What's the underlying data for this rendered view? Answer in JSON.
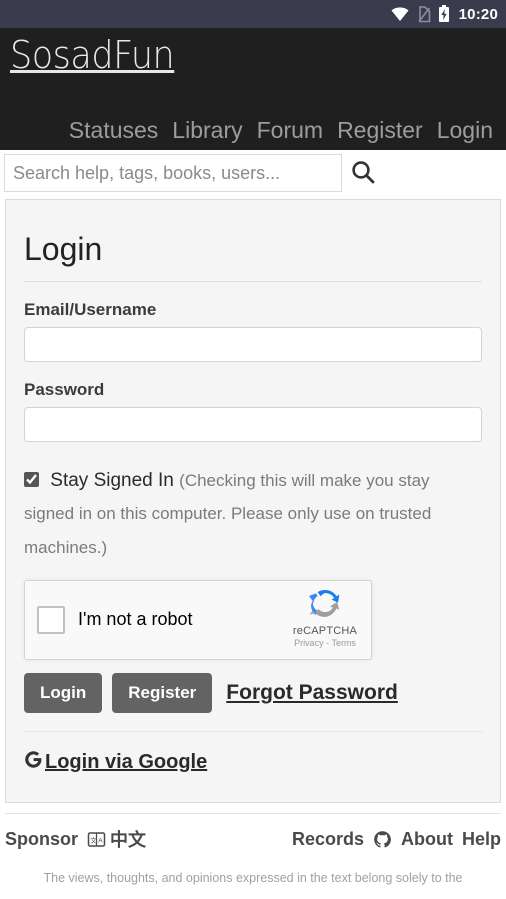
{
  "statusbar": {
    "time": "10:20",
    "icons": [
      "wifi-icon",
      "no-sim-icon",
      "battery-charging-icon"
    ]
  },
  "header": {
    "logo": "SosadFun",
    "nav": [
      {
        "label": "Statuses"
      },
      {
        "label": "Library"
      },
      {
        "label": "Forum"
      },
      {
        "label": "Register"
      },
      {
        "label": "Login"
      }
    ]
  },
  "search": {
    "placeholder": "Search help, tags, books, users...",
    "value": "",
    "icon": "search-icon"
  },
  "login_card": {
    "title": "Login",
    "email_label": "Email/Username",
    "email_value": "",
    "password_label": "Password",
    "password_value": "",
    "stay_signed_in": {
      "label": "Stay Signed In",
      "checked": true,
      "hint": "(Checking this will make you stay signed in on this computer. Please only use on trusted machines.)"
    },
    "recaptcha": {
      "label": "I'm not a robot",
      "brand": "reCAPTCHA",
      "privacy": "Privacy",
      "separator": "-",
      "terms": "Terms",
      "checked": false
    },
    "buttons": {
      "login": "Login",
      "register": "Register",
      "forgot_password": "Forgot Password"
    },
    "google_login": {
      "label": "Login via Google",
      "icon": "google-g-icon"
    }
  },
  "footer": {
    "left": [
      {
        "label": "Sponsor",
        "type": "link"
      },
      {
        "label": "",
        "type": "icon",
        "icon": "translate-icon"
      },
      {
        "label": "中文",
        "type": "link"
      }
    ],
    "right": [
      {
        "label": "Records",
        "type": "link"
      },
      {
        "label": "",
        "type": "icon",
        "icon": "github-icon"
      },
      {
        "label": "About",
        "type": "link"
      },
      {
        "label": "Help",
        "type": "link"
      }
    ],
    "disclaimer": "The views, thoughts, and opinions expressed in the text belong solely to the"
  },
  "colors": {
    "statusbar_bg": "#3a3b4d",
    "header_bg": "#1f1f1f",
    "card_bg": "#f5f5f5",
    "button_bg": "#636363",
    "nav_link": "#9d9d9d"
  }
}
